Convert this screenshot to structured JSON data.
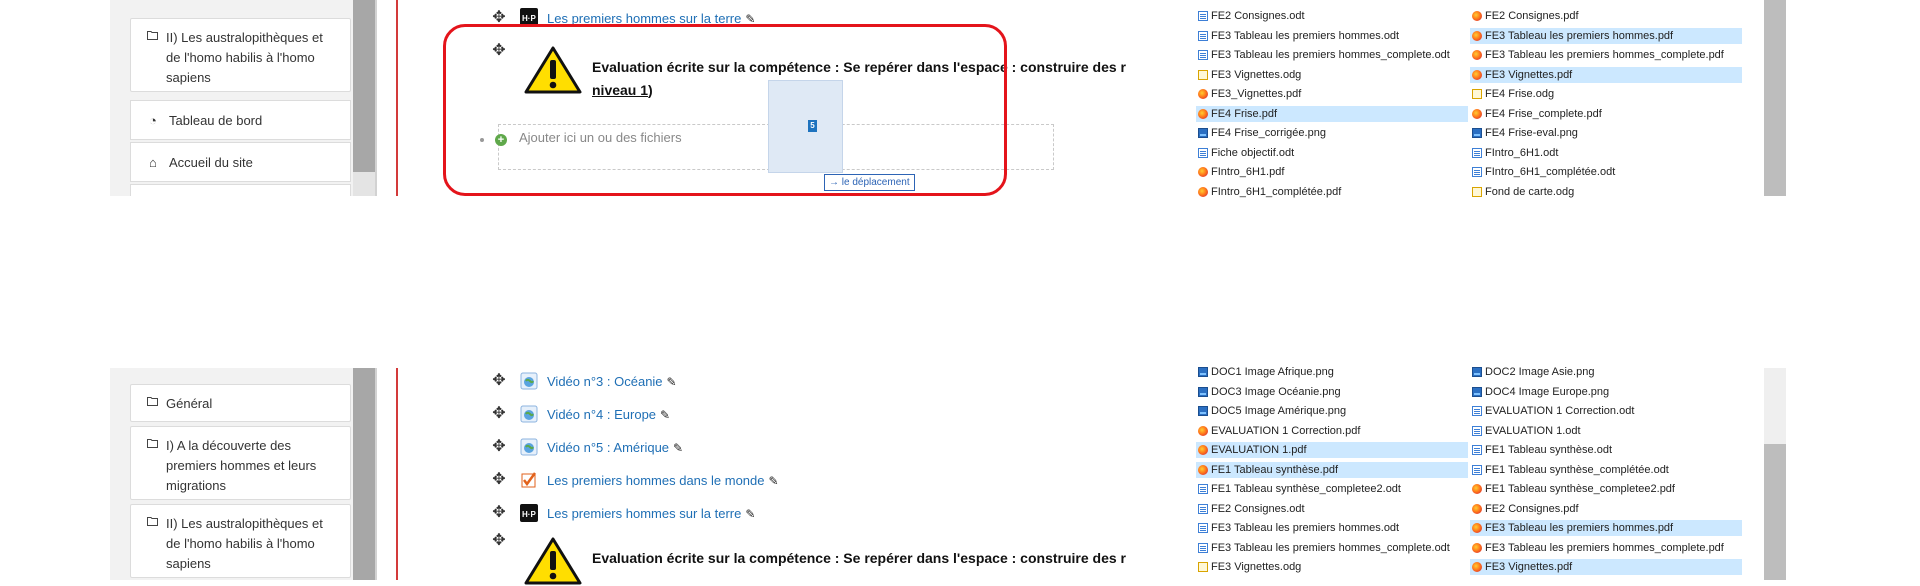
{
  "top": {
    "sidebar": {
      "section": "II) Les australopithèques et de l'homo habilis à l'homo sapiens",
      "links": [
        {
          "icon": "dashboard-icon",
          "label": "Tableau de bord"
        },
        {
          "icon": "home-icon",
          "label": "Accueil du site"
        }
      ]
    },
    "activity_h5p": "Les premiers hommes sur la terre",
    "label_activity": {
      "title_line1": "Evaluation écrite sur la compétence : Se repérer dans l'espace : construire des r",
      "title_line2_link": "niveau 1",
      "title_line2_tail": ")"
    },
    "dropzone_label": "Ajouter ici un ou des fichiers",
    "drag_badge": "5",
    "drag_tooltip": "le déplacement",
    "files_left": [
      {
        "name": "FE2 Consignes.odt",
        "type": "odt",
        "selected": false
      },
      {
        "name": "FE3 Tableau les premiers hommes.odt",
        "type": "odt",
        "selected": false
      },
      {
        "name": "FE3 Tableau les premiers hommes_complete.odt",
        "type": "odt",
        "selected": false
      },
      {
        "name": "FE3 Vignettes.odg",
        "type": "odg",
        "selected": false
      },
      {
        "name": "FE3_Vignettes.pdf",
        "type": "pdf",
        "selected": false
      },
      {
        "name": "FE4 Frise.pdf",
        "type": "pdf",
        "selected": true
      },
      {
        "name": "FE4 Frise_corrigée.png",
        "type": "png",
        "selected": false
      },
      {
        "name": "Fiche objectif.odt",
        "type": "odt",
        "selected": false
      },
      {
        "name": "FIntro_6H1.pdf",
        "type": "pdf",
        "selected": false
      },
      {
        "name": "FIntro_6H1_complétée.pdf",
        "type": "pdf",
        "selected": false
      }
    ],
    "files_right": [
      {
        "name": "FE2 Consignes.pdf",
        "type": "pdf",
        "selected": false
      },
      {
        "name": "FE3 Tableau les premiers hommes.pdf",
        "type": "pdf",
        "selected": true
      },
      {
        "name": "FE3 Tableau les premiers hommes_complete.pdf",
        "type": "pdf",
        "selected": false
      },
      {
        "name": "FE3 Vignettes.pdf",
        "type": "pdf",
        "selected": true
      },
      {
        "name": "FE4 Frise.odg",
        "type": "odg",
        "selected": false
      },
      {
        "name": "FE4 Frise_complete.pdf",
        "type": "pdf",
        "selected": false
      },
      {
        "name": "FE4 Frise-eval.png",
        "type": "png",
        "selected": false
      },
      {
        "name": "FIntro_6H1.odt",
        "type": "odt",
        "selected": false
      },
      {
        "name": "FIntro_6H1_complétée.odt",
        "type": "odt",
        "selected": false
      },
      {
        "name": "Fond de carte.odg",
        "type": "odg",
        "selected": false
      }
    ]
  },
  "bottom": {
    "sidebar": {
      "sections": [
        "Général",
        "I) A la découverte des premiers hommes et leurs migrations",
        "II) Les australopithèques et de l'homo habilis à l'homo sapiens"
      ]
    },
    "activities": [
      {
        "icon": "url-globe-icon",
        "label": "Vidéo n°3 : Océanie"
      },
      {
        "icon": "url-globe-icon",
        "label": "Vidéo n°4 : Europe"
      },
      {
        "icon": "url-globe-icon",
        "label": "Vidéo n°5 : Amérique"
      },
      {
        "icon": "quiz-icon",
        "label": "Les premiers hommes dans le monde"
      },
      {
        "icon": "h5p-icon",
        "label": "Les premiers hommes sur la terre"
      }
    ],
    "label_title": "Evaluation écrite sur la compétence : Se repérer dans l'espace : construire des r",
    "files_left": [
      {
        "name": "DOC1 Image Afrique.png",
        "type": "png",
        "selected": false
      },
      {
        "name": "DOC3 Image Océanie.png",
        "type": "png",
        "selected": false
      },
      {
        "name": "DOC5 Image Amérique.png",
        "type": "png",
        "selected": false
      },
      {
        "name": "EVALUATION 1 Correction.pdf",
        "type": "pdf",
        "selected": false
      },
      {
        "name": "EVALUATION 1.pdf",
        "type": "pdf",
        "selected": true
      },
      {
        "name": "FE1 Tableau synthèse.pdf",
        "type": "pdf",
        "selected": true
      },
      {
        "name": "FE1 Tableau synthèse_completee2.odt",
        "type": "odt",
        "selected": false
      },
      {
        "name": "FE2 Consignes.odt",
        "type": "odt",
        "selected": false
      },
      {
        "name": "FE3 Tableau les premiers hommes.odt",
        "type": "odt",
        "selected": false
      },
      {
        "name": "FE3 Tableau les premiers hommes_complete.odt",
        "type": "odt",
        "selected": false
      },
      {
        "name": "FE3 Vignettes.odg",
        "type": "odg",
        "selected": false
      }
    ],
    "files_right": [
      {
        "name": "DOC2 Image Asie.png",
        "type": "png",
        "selected": false
      },
      {
        "name": "DOC4 Image Europe.png",
        "type": "png",
        "selected": false
      },
      {
        "name": "EVALUATION 1 Correction.odt",
        "type": "odt",
        "selected": false
      },
      {
        "name": "EVALUATION 1.odt",
        "type": "odt",
        "selected": false
      },
      {
        "name": "FE1 Tableau synthèse.odt",
        "type": "odt",
        "selected": false
      },
      {
        "name": "FE1 Tableau synthèse_complétée.odt",
        "type": "odt",
        "selected": false
      },
      {
        "name": "FE1 Tableau synthèse_completee2.pdf",
        "type": "pdf",
        "selected": false
      },
      {
        "name": "FE2 Consignes.pdf",
        "type": "pdf",
        "selected": false
      },
      {
        "name": "FE3 Tableau les premiers hommes.pdf",
        "type": "pdf",
        "selected": true
      },
      {
        "name": "FE3 Tableau les premiers hommes_complete.pdf",
        "type": "pdf",
        "selected": false
      },
      {
        "name": "FE3 Vignettes.pdf",
        "type": "pdf",
        "selected": true
      }
    ]
  },
  "colors": {
    "link": "#1f6fb5",
    "highlight_frame": "#e4141b",
    "selection": "#cce8ff"
  }
}
